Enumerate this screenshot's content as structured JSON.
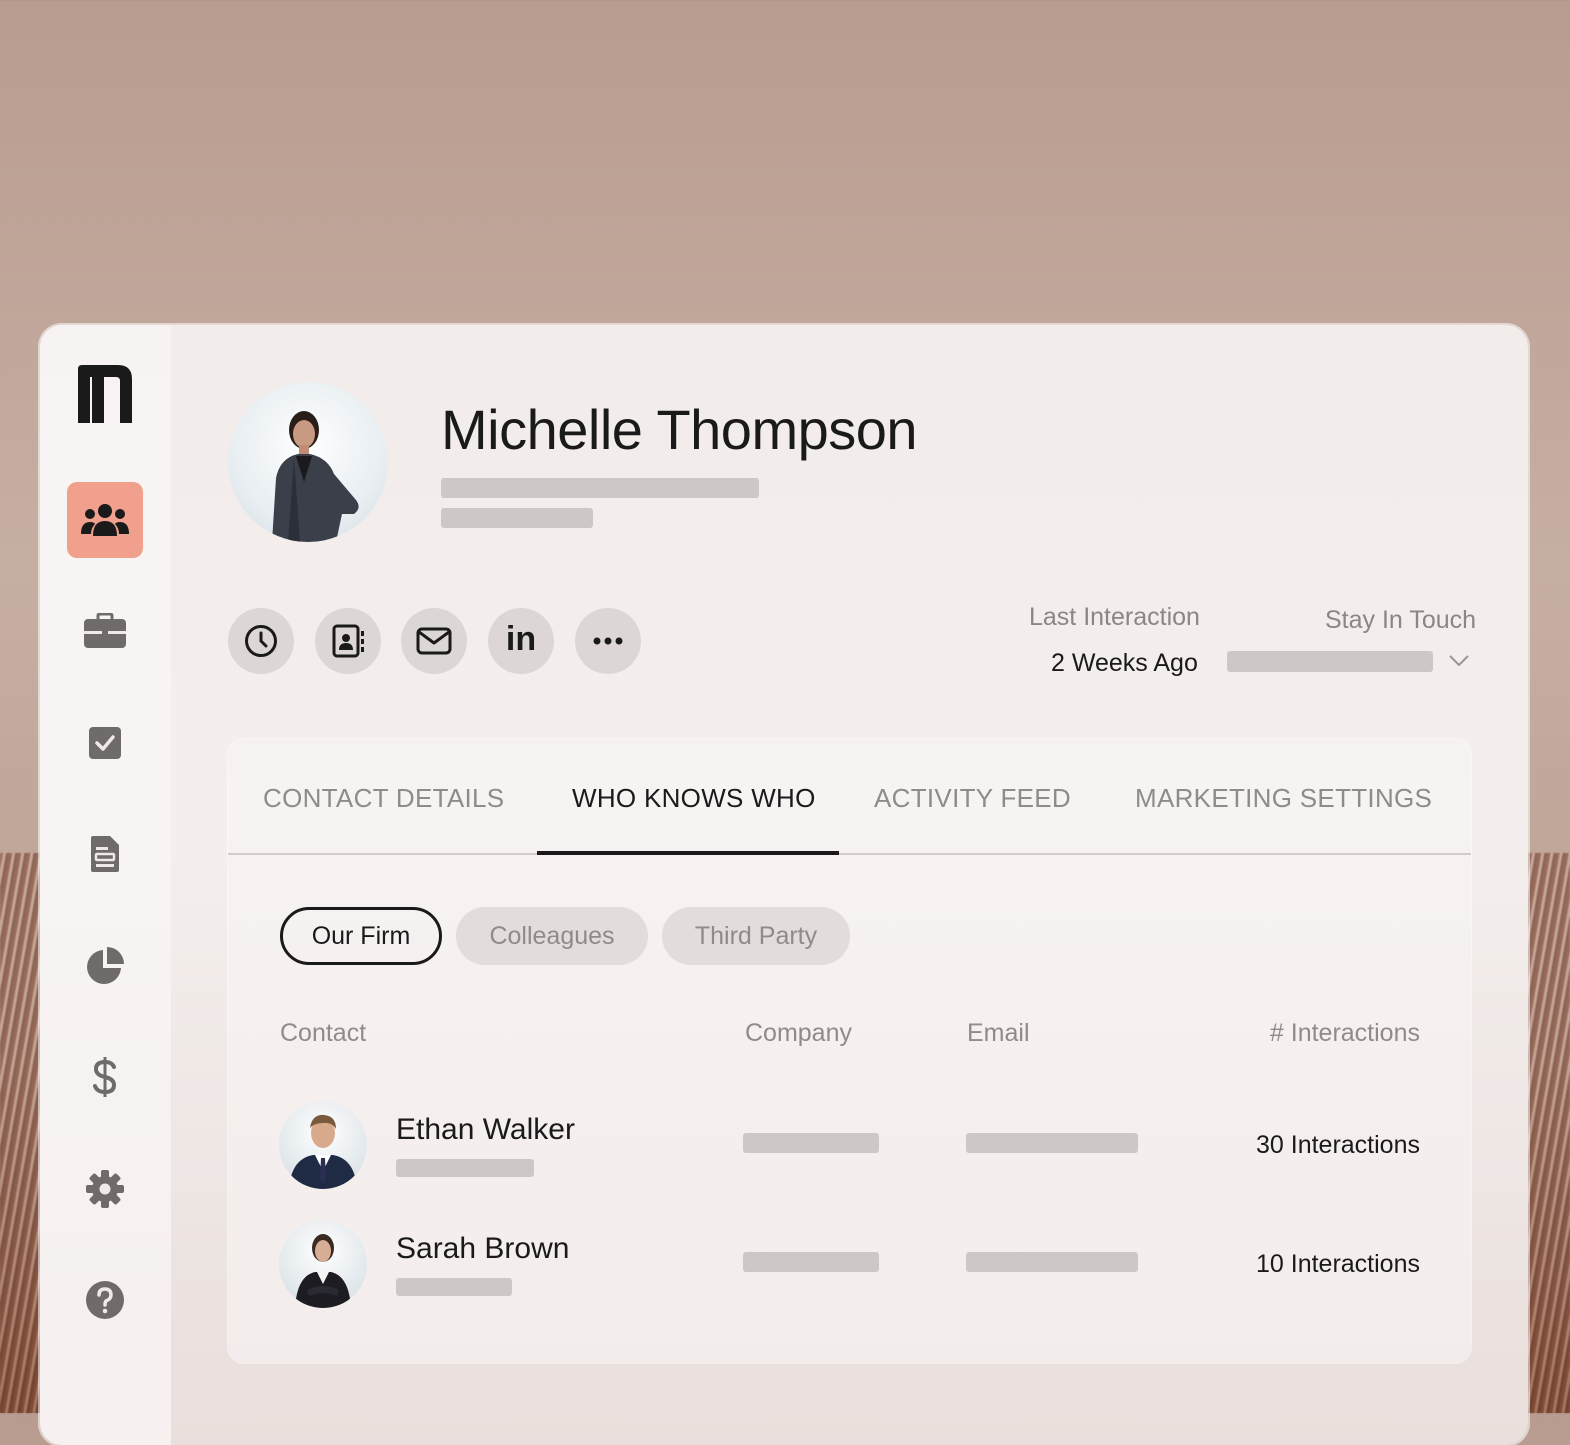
{
  "colors": {
    "accent": "#f2a08e",
    "text_primary": "#1a1a1a",
    "text_muted": "#8e8b8a",
    "placeholder": "#cdc8c6"
  },
  "sidebar": {
    "logo_icon": "app-logo",
    "items": [
      {
        "icon": "people-icon",
        "active": true
      },
      {
        "icon": "briefcase-icon",
        "active": false
      },
      {
        "icon": "checkbox-icon",
        "active": false
      },
      {
        "icon": "document-icon",
        "active": false
      },
      {
        "icon": "pie-chart-icon",
        "active": false
      },
      {
        "icon": "dollar-icon",
        "active": false
      },
      {
        "icon": "gear-icon",
        "active": false
      },
      {
        "icon": "help-icon",
        "active": false
      }
    ]
  },
  "profile": {
    "name": "Michelle Thompson",
    "actions": [
      "clock-icon",
      "contact-card-icon",
      "mail-icon",
      "linkedin-icon",
      "more-icon"
    ],
    "linkedin_label": "in",
    "last_interaction_label": "Last Interaction",
    "last_interaction_value": "2 Weeks Ago",
    "stay_in_touch_label": "Stay In Touch"
  },
  "tabs": [
    {
      "label": "CONTACT DETAILS",
      "active": false
    },
    {
      "label": "WHO KNOWS WHO",
      "active": true
    },
    {
      "label": "ACTIVITY FEED",
      "active": false
    },
    {
      "label": "MARKETING SETTINGS",
      "active": false
    }
  ],
  "filters": [
    {
      "label": "Our Firm",
      "active": true
    },
    {
      "label": "Colleagues",
      "active": false
    },
    {
      "label": "Third Party",
      "active": false
    }
  ],
  "table": {
    "headers": {
      "contact": "Contact",
      "company": "Company",
      "email": "Email",
      "interactions": "# Interactions"
    },
    "rows": [
      {
        "name": "Ethan Walker",
        "interactions": "30 Interactions"
      },
      {
        "name": "Sarah Brown",
        "interactions": "10 Interactions"
      }
    ]
  }
}
